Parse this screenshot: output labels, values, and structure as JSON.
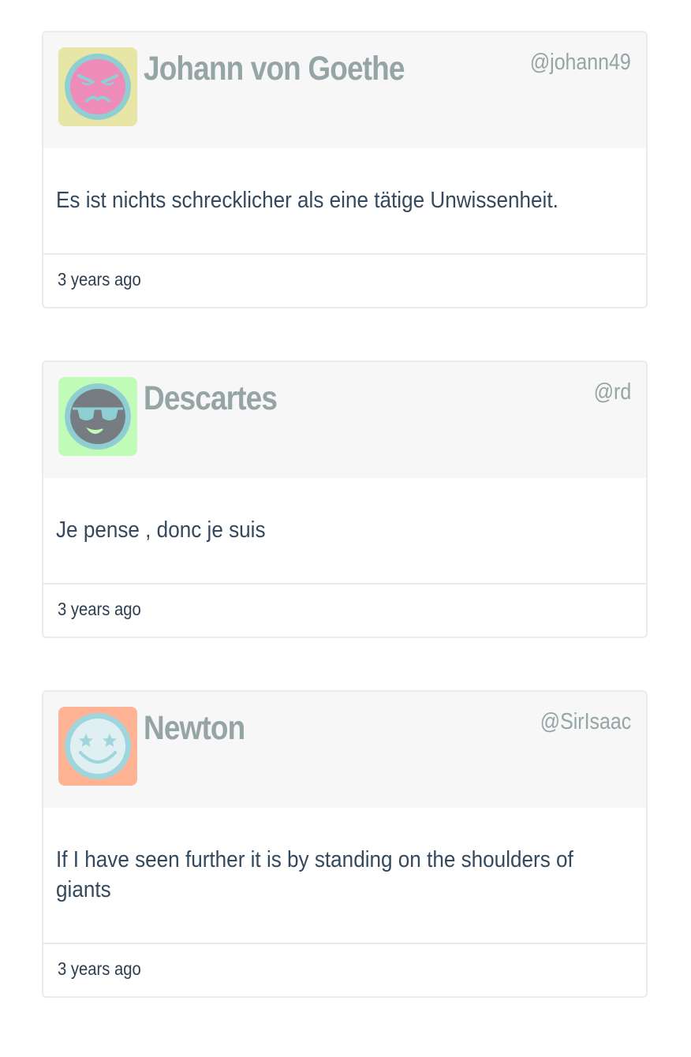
{
  "posts": [
    {
      "name": "Johann von Goethe",
      "handle": "@johann49",
      "quote": "Es ist nichts schrecklicher als eine tätige Unwissenheit.",
      "time": "3 years ago",
      "avatar": {
        "icon": "angry-face-icon",
        "bg": "#e8e6a6",
        "face": "#ef8bb8",
        "ring": "#8fcfd3"
      }
    },
    {
      "name": "Descartes",
      "handle": "@rd",
      "quote": "Je pense , donc je suis",
      "time": "3 years ago",
      "avatar": {
        "icon": "sunglasses-face-icon",
        "bg": "#c1fbb8",
        "face": "#767c82",
        "ring": "#8fcfd3"
      }
    },
    {
      "name": "Newton",
      "handle": "@SirIsaac",
      "quote": "If I have seen further it is by standing on the shoulders of giants",
      "time": "3 years ago",
      "avatar": {
        "icon": "star-eyes-face-icon",
        "bg": "#fdb394",
        "face": "#e0f0f2",
        "ring": "#9fd5dc"
      }
    }
  ]
}
